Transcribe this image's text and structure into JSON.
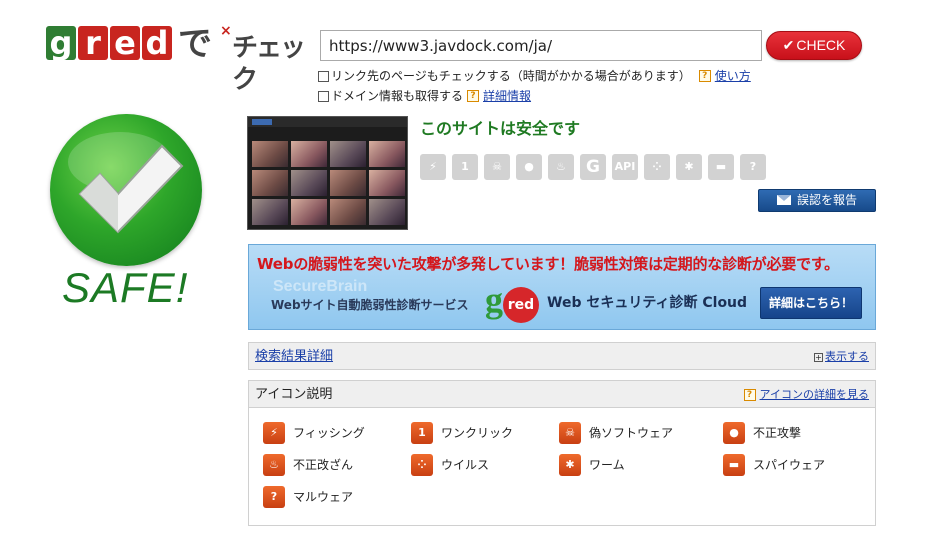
{
  "logo": {
    "g": "g",
    "r": "r",
    "e": "e",
    "d": "d",
    "de": "で",
    "check": "チェック"
  },
  "search": {
    "url_value": "https://www3.javdock.com/ja/",
    "check_label": "CHECK",
    "option1_label": "リンク先のページもチェックする（時間がかかる場合があります）",
    "option1_link": "使い方",
    "option2_label": "ドメイン情報も取得する",
    "option2_link": "詳細情報"
  },
  "result": {
    "badge_text": "SAFE!",
    "message": "このサイトは安全です",
    "report_label": "誤認を報告",
    "threat_icons": [
      {
        "icon": "phishing-icon",
        "glyph": "⚡"
      },
      {
        "icon": "one-click-icon",
        "glyph": "1"
      },
      {
        "icon": "fake-software-icon",
        "glyph": "☠"
      },
      {
        "icon": "attack-icon",
        "glyph": "●"
      },
      {
        "icon": "tampering-icon",
        "glyph": "♨"
      },
      {
        "icon": "g-icon",
        "glyph": "G"
      },
      {
        "icon": "api-icon",
        "glyph": "API"
      },
      {
        "icon": "virus-icon",
        "glyph": "⁘"
      },
      {
        "icon": "worm-icon",
        "glyph": "✱"
      },
      {
        "icon": "spyware-icon",
        "glyph": "▬"
      },
      {
        "icon": "malware-icon",
        "glyph": "?"
      }
    ]
  },
  "banner": {
    "headline": "Webの脆弱性を突いた攻撃が多発しています！脆弱性対策は定期的な診断が必要です。",
    "watermark": "SecureBrain",
    "service": "Webサイト自動脆弱性診断サービス",
    "logo_g": "g",
    "logo_red": "red",
    "cloud": "Web セキュリティ診断 Cloud",
    "detail_label": "詳細はこちら！"
  },
  "results_panel": {
    "title": "検索結果詳細",
    "show_label": "表示する",
    "plus": "+"
  },
  "legend_panel": {
    "title": "アイコン説明",
    "link": "アイコンの詳細を見る",
    "items": [
      {
        "label": "フィッシング",
        "glyph": "⚡"
      },
      {
        "label": "ワンクリック",
        "glyph": "1"
      },
      {
        "label": "偽ソフトウェア",
        "glyph": "☠"
      },
      {
        "label": "不正攻撃",
        "glyph": "●"
      },
      {
        "label": "不正改ざん",
        "glyph": "♨"
      },
      {
        "label": "ウイルス",
        "glyph": "⁘"
      },
      {
        "label": "ワーム",
        "glyph": "✱"
      },
      {
        "label": "スパイウェア",
        "glyph": "▬"
      },
      {
        "label": "マルウェア",
        "glyph": "?"
      }
    ]
  },
  "colors": {
    "safe_green": "#1f7a22",
    "check_red": "#d41a22",
    "banner_red": "#d4171c",
    "link_blue": "#1a3fa8"
  }
}
